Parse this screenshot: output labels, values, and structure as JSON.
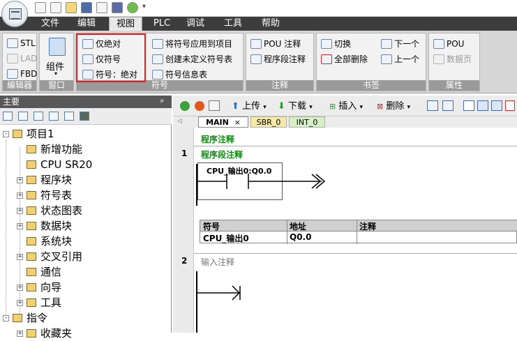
{
  "menu": {
    "tabs": [
      "文件",
      "编辑",
      "视图",
      "PLC",
      "调试",
      "工具",
      "帮助"
    ],
    "active": "视图"
  },
  "ribbon": {
    "editor_group": {
      "title": "编辑器",
      "items": [
        "STL",
        "LAD",
        "FBD"
      ]
    },
    "window_group": {
      "title": "窗口",
      "button": "组件"
    },
    "symbol_group": {
      "title": "符号",
      "items": [
        "仅绝对",
        "仅符号",
        "符号：绝对",
        "将符号应用到项目",
        "创建未定义符号表",
        "符号信息表"
      ]
    },
    "comment_group": {
      "title": "注释",
      "items": [
        "POU 注释",
        "程序段注释"
      ]
    },
    "bookmark_group": {
      "title": "书签",
      "items": [
        "切换",
        "全部删除",
        "下一个",
        "上一个"
      ]
    },
    "property_group": {
      "title": "属性",
      "items": [
        "POU",
        "数据页"
      ]
    }
  },
  "left_panel": {
    "title": "主要",
    "pin": "ᵖ",
    "tree": [
      {
        "label": "项目1",
        "level": 0,
        "expander": "-"
      },
      {
        "label": "新增功能",
        "level": 1
      },
      {
        "label": "CPU SR20",
        "level": 1
      },
      {
        "label": "程序块",
        "level": 1,
        "expander": "+"
      },
      {
        "label": "符号表",
        "level": 1,
        "expander": "+"
      },
      {
        "label": "状态图表",
        "level": 1,
        "expander": "+"
      },
      {
        "label": "数据块",
        "level": 1,
        "expander": "+"
      },
      {
        "label": "系统块",
        "level": 1
      },
      {
        "label": "交叉引用",
        "level": 1,
        "expander": "+"
      },
      {
        "label": "通信",
        "level": 1
      },
      {
        "label": "向导",
        "level": 1,
        "expander": "+"
      },
      {
        "label": "工具",
        "level": 1,
        "expander": "+"
      },
      {
        "label": "指令",
        "level": 0,
        "expander": "-"
      },
      {
        "label": "收藏夹",
        "level": 1,
        "expander": "+"
      }
    ]
  },
  "toolbar": {
    "upload": "上传",
    "download": "下载",
    "insert": "插入",
    "delete": "删除"
  },
  "pou_tabs": [
    "MAIN",
    "SBR_0",
    "INT_0"
  ],
  "pou_tab_close": "×",
  "editor": {
    "program_comment": "程序注释",
    "networks": [
      {
        "number": "1",
        "comment": "程序段注释",
        "contact": "CPU_输出0:Q0.0",
        "symbol_table": {
          "headers": [
            "符号",
            "地址",
            "注释"
          ],
          "rows": [
            [
              "CPU_输出0",
              "Q0.0",
              ""
            ]
          ]
        }
      },
      {
        "number": "2",
        "comment": "输入注释"
      }
    ]
  },
  "colors": {
    "comment_green": "#118811",
    "highlight_red": "#e02020",
    "menu_bar": "#3d3d3d",
    "group_footer": "#9a9a9a"
  }
}
